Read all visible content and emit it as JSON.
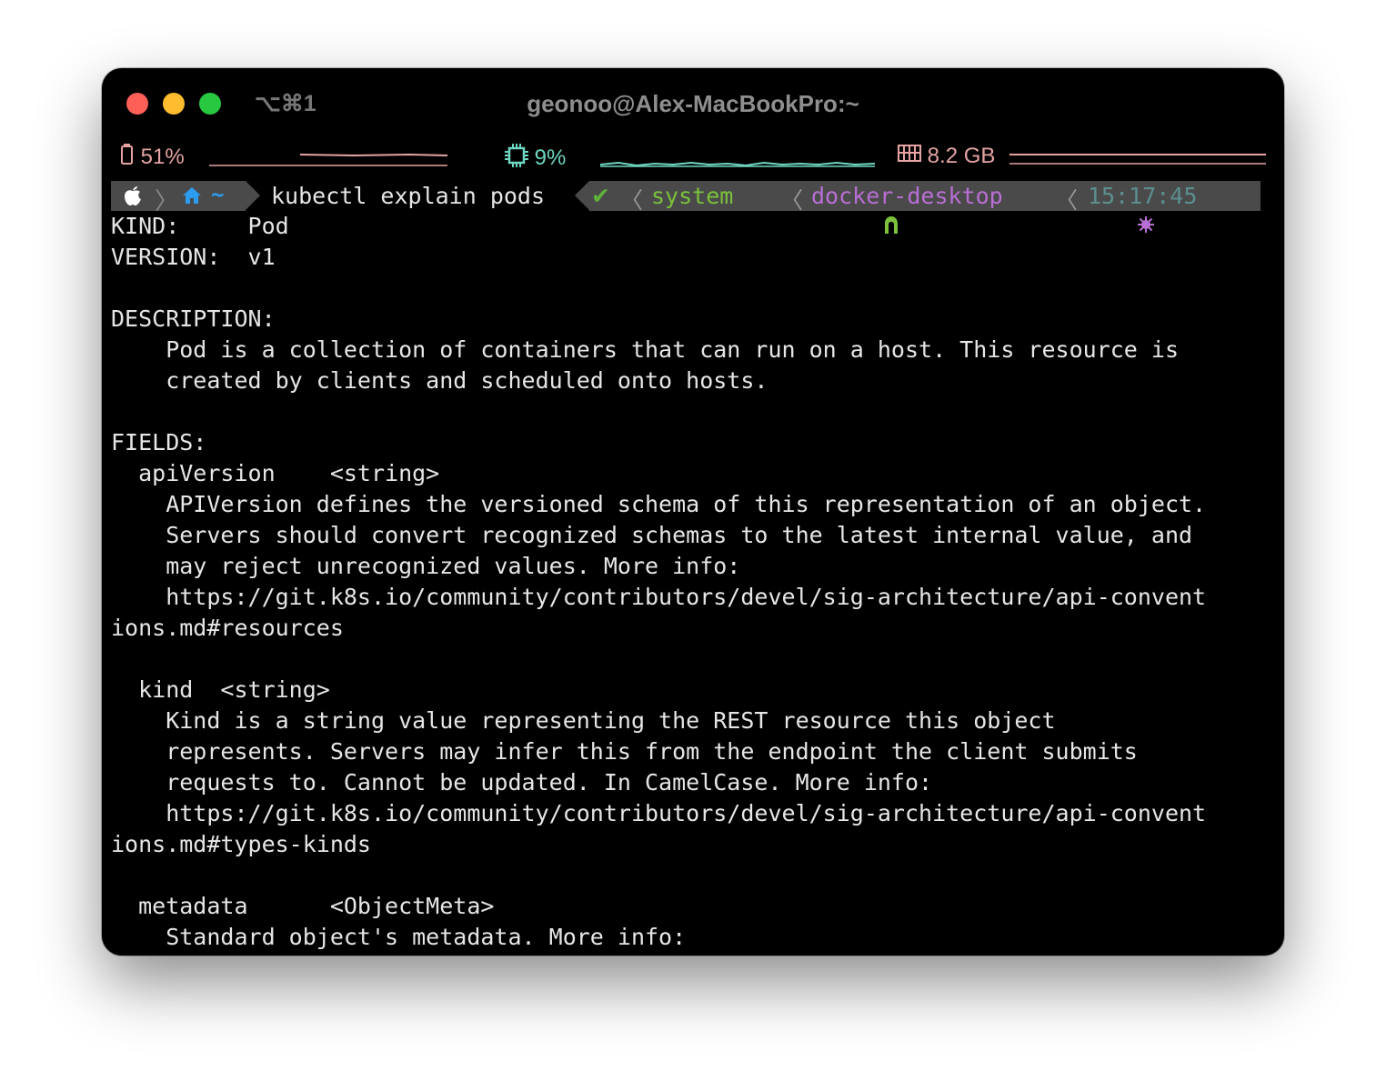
{
  "window": {
    "title": "geonoo@Alex-MacBookPro:~",
    "shortcut": "⌥⌘1"
  },
  "status": {
    "battery": "51%",
    "cpu": "9%",
    "memory": "8.2 GB",
    "colors": {
      "battery": "#e5a3a3",
      "cpu": "#6fd6c1",
      "memory": "#e5a3a3"
    }
  },
  "prompt": {
    "apple_icon": "apple-icon",
    "home_icon": "home-icon",
    "path": "~",
    "command": "kubectl explain pods",
    "check": "✔",
    "user": "system",
    "k8s_context": "docker-desktop",
    "time": "15:17:45",
    "colors": {
      "user": "#7bc13c",
      "context": "#b86fd4",
      "time": "#5c8e8e",
      "check": "#5fb23a"
    }
  },
  "output": {
    "lines": [
      "KIND:     Pod",
      "VERSION:  v1",
      "",
      "DESCRIPTION:",
      "    Pod is a collection of containers that can run on a host. This resource is",
      "    created by clients and scheduled onto hosts.",
      "",
      "FIELDS:",
      "  apiVersion\t<string>",
      "    APIVersion defines the versioned schema of this representation of an object.",
      "    Servers should convert recognized schemas to the latest internal value, and",
      "    may reject unrecognized values. More info:",
      "    https://git.k8s.io/community/contributors/devel/sig-architecture/api-convent",
      "ions.md#resources",
      "",
      "  kind\t<string>",
      "    Kind is a string value representing the REST resource this object",
      "    represents. Servers may infer this from the endpoint the client submits",
      "    requests to. Cannot be updated. In CamelCase. More info:",
      "    https://git.k8s.io/community/contributors/devel/sig-architecture/api-convent",
      "ions.md#types-kinds",
      "",
      "  metadata\t<ObjectMeta>",
      "    Standard object's metadata. More info:"
    ]
  }
}
